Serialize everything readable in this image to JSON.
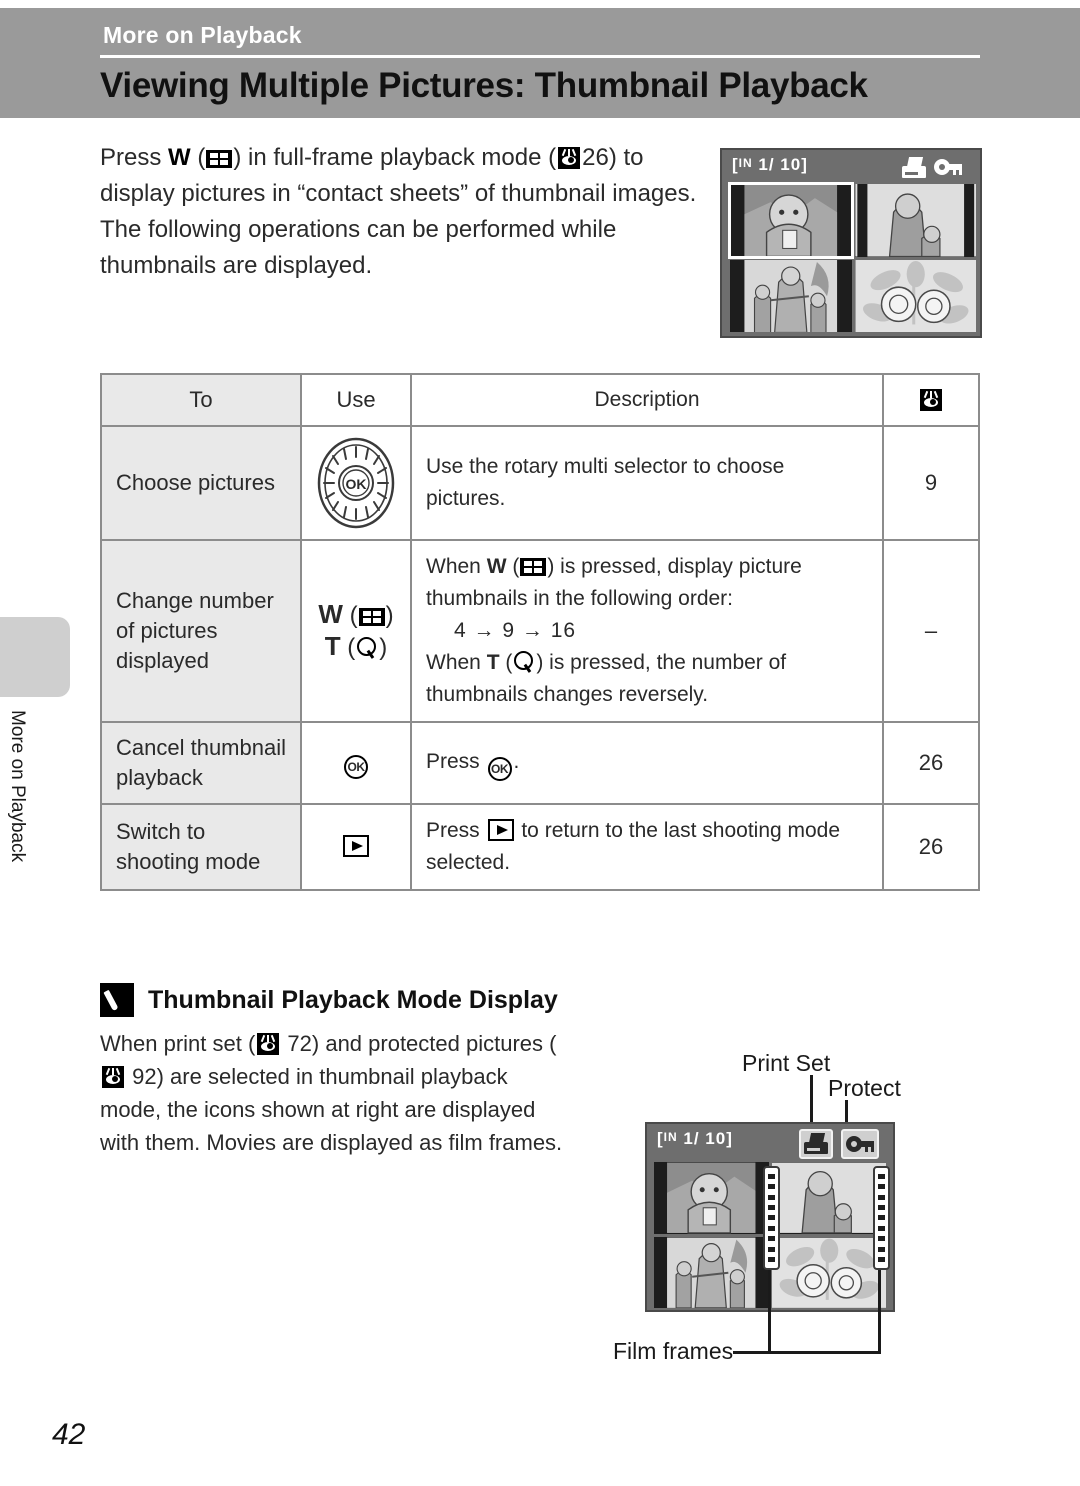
{
  "header": {
    "chapter": "More on Playback",
    "title": "Viewing Multiple Pictures: Thumbnail Playback"
  },
  "side_tab": {
    "label": "More on Playback"
  },
  "intro": {
    "part1": "Press ",
    "w": "W",
    "part2": " (",
    "part3": ") in full-frame playback mode (",
    "ref": "26",
    "part4": ") to display pictures in “contact sheets” of thumbnail images. The following operations can be performed while thumbnails are displayed."
  },
  "lcd_top": {
    "memory": "IN",
    "counter": "1/ 10",
    "icons": [
      "print-icon",
      "protect-key-icon"
    ]
  },
  "table": {
    "headers": {
      "to": "To",
      "use": "Use",
      "description": "Description",
      "ref": "page-reference-icon"
    },
    "rows": [
      {
        "to": "Choose pictures",
        "use_icon": "rotary-multi-selector-dial",
        "use_label": "OK",
        "description": "Use the rotary multi selector to choose pictures.",
        "ref": "9"
      },
      {
        "to": "Change number of pictures displayed",
        "use_w": "W",
        "use_t": "T",
        "desc_line1_a": "When ",
        "desc_line1_b": " (",
        "desc_line1_c": ") is pressed, display picture thumbnails in the following order:",
        "desc_sequence": "4 → 9 → 16",
        "desc_line2_a": "When ",
        "desc_line2_b": " (",
        "desc_line2_c": ") is pressed, the number of thumbnails changes reversely.",
        "ref": "–"
      },
      {
        "to": "Cancel thumbnail playback",
        "use_icon": "ok-button-icon",
        "desc_a": "Press ",
        "desc_b": ".",
        "ref": "26"
      },
      {
        "to": "Switch to shooting mode",
        "use_icon": "playback-button-icon",
        "desc_a": "Press ",
        "desc_b": " to return to the last shooting mode selected.",
        "ref": "26"
      }
    ]
  },
  "note": {
    "title": "Thumbnail Playback Mode Display",
    "line1_a": "When print set (",
    "line1_ref": "72",
    "line1_b": ") and protected pictures",
    "line2_a": "(",
    "line2_ref": "92",
    "line2_b": ") are selected in thumbnail playback mode, the icons shown at right are displayed with them. Movies are displayed as film frames."
  },
  "lcd_bottom": {
    "memory": "IN",
    "counter": "1/ 10",
    "callouts": {
      "print_set": "Print Set",
      "protect": "Protect",
      "film_frames": "Film frames"
    }
  },
  "footer": {
    "page_number": "42"
  },
  "colors": {
    "header_band": "#9a9a9a",
    "table_header_bg": "#e6e6e6",
    "first_column_bg": "#e9e9e9",
    "lcd_bg": "#6e6e6e",
    "border": "#8c8c8c"
  }
}
